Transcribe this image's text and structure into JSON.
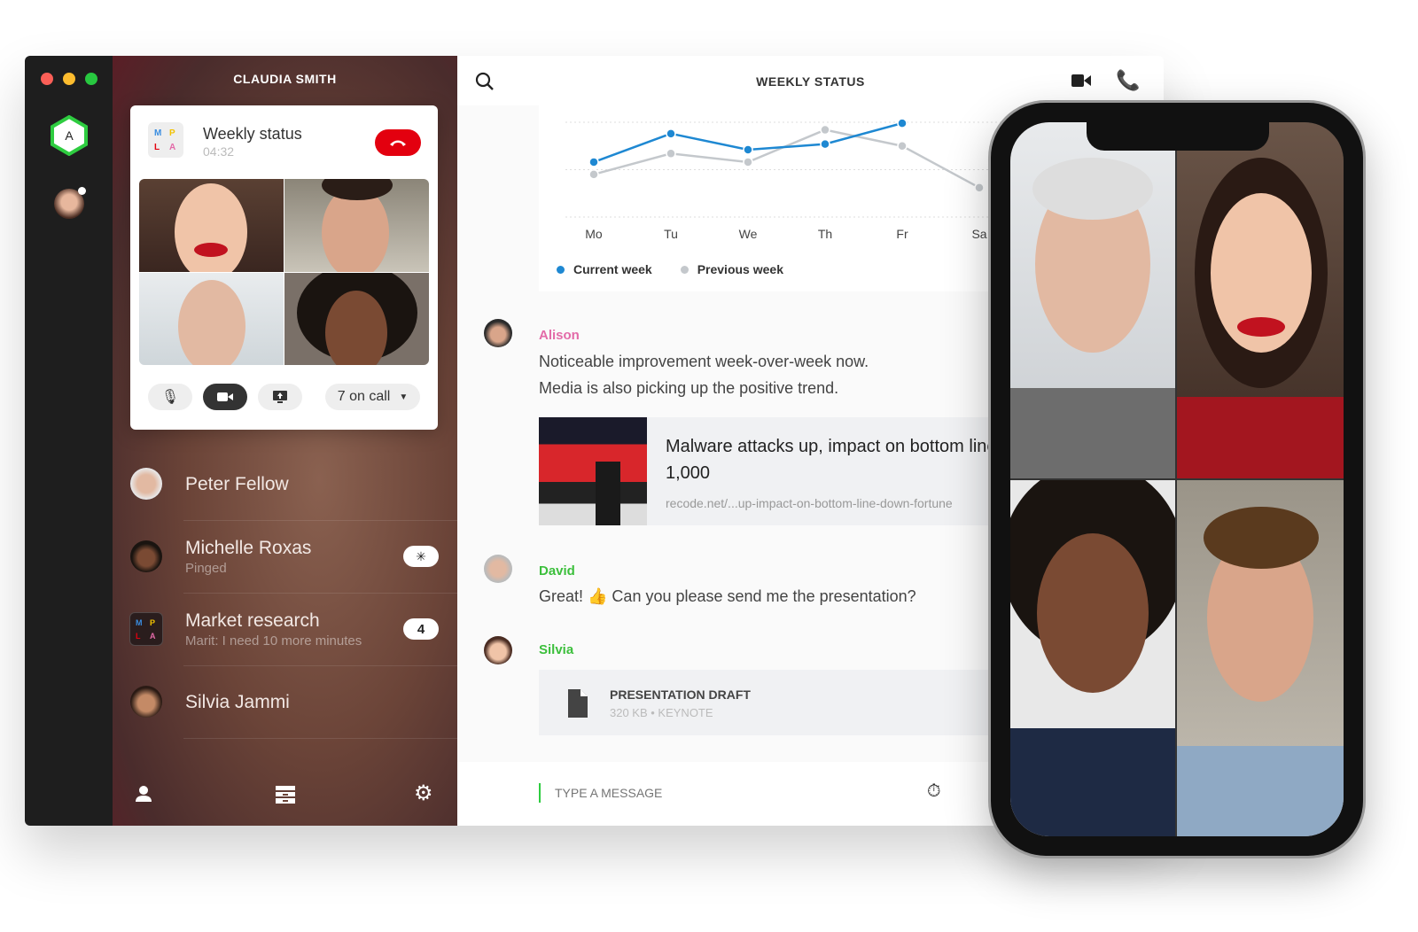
{
  "window": {
    "user_name": "CLAUDIA SMITH",
    "rail_avatar_letter": "A"
  },
  "call": {
    "title": "Weekly status",
    "duration": "04:32",
    "group_letters": [
      "M",
      "P",
      "L",
      "A"
    ],
    "on_call_label": "7 on call",
    "colors": {
      "end_call": "#e3000f"
    }
  },
  "contacts": [
    {
      "name": "Peter Fellow",
      "sub": "",
      "badge": ""
    },
    {
      "name": "Michelle Roxas",
      "sub": "Pinged",
      "badge": "spinner"
    },
    {
      "name": "Market research",
      "sub": "Marit: I need 10 more minutes",
      "badge": "4"
    },
    {
      "name": "Silvia Jammi",
      "sub": "",
      "badge": ""
    }
  ],
  "header": {
    "title": "WEEKLY STATUS"
  },
  "chart_data": {
    "type": "line",
    "categories": [
      "Mo",
      "Tu",
      "We",
      "Th",
      "Fr",
      "Sa"
    ],
    "series": [
      {
        "name": "Current week",
        "values": [
          58,
          88,
          71,
          77,
          99,
          null
        ],
        "color": "#1e88d2"
      },
      {
        "name": "Previous week",
        "values": [
          45,
          67,
          58,
          92,
          75,
          31
        ],
        "color": "#c4c8cc"
      }
    ],
    "ylim": [
      0,
      100
    ],
    "grid": true,
    "legend": "bottom-left"
  },
  "messages": [
    {
      "sender": "Alison",
      "color": "#e36aa8",
      "lines": [
        "Noticeable improvement week-over-week now.",
        "Media is also picking up the positive trend."
      ],
      "link": {
        "title": "Malware attacks up, impact on bottom line down for Fortune 1,000",
        "url": "recode.net/...up-impact-on-bottom-line-down-fortune"
      }
    },
    {
      "sender": "David",
      "color": "#3cbf3c",
      "lines": [
        "Great! 👍 Can you please send me the presentation?"
      ]
    },
    {
      "sender": "Silvia",
      "color": "#3cbf3c",
      "file": {
        "name": "PRESENTATION DRAFT",
        "meta": "320 KB • KEYNOTE"
      }
    }
  ],
  "composer": {
    "placeholder": "TYPE A MESSAGE"
  }
}
